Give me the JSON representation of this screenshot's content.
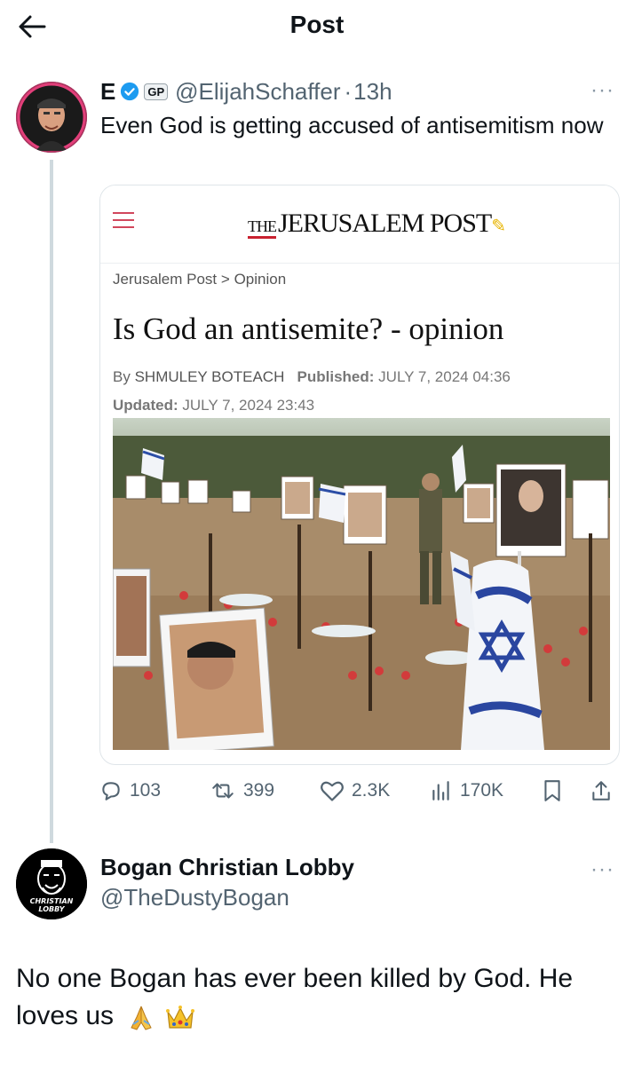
{
  "header": {
    "title": "Post",
    "back_icon": "arrow-left-icon"
  },
  "tweet1": {
    "name": "E",
    "badge": "GP",
    "handle": "@ElijahSchaffer",
    "separator": "·",
    "time": "13h",
    "text": "Even God is getting accused of antisemitism now",
    "more": "···",
    "card": {
      "masthead_the": "THE",
      "masthead": "JERUSALEM POST",
      "breadcrumb_site": "Jerusalem Post",
      "breadcrumb_sep": ">",
      "breadcrumb_section": "Opinion",
      "title": "Is God an antisemite? - opinion",
      "by_label": "By",
      "author": "SHMULEY BOTEACH",
      "published_label": "Published:",
      "published": "JULY 7, 2024 04:36",
      "updated_label": "Updated:",
      "updated": "JULY 7, 2024 23:43"
    },
    "stats": {
      "replies": "103",
      "reposts": "399",
      "likes": "2.3K",
      "views": "170K"
    }
  },
  "tweet2": {
    "name": "Bogan Christian Lobby",
    "handle": "@TheDustyBogan",
    "avatar_text": "CHRISTIAN LOBBY",
    "text": "No one Bogan has ever been killed by God. He loves us",
    "emojis": "🙏👑",
    "more": "···"
  },
  "colors": {
    "accent_blue": "#1d9bf0",
    "muted": "#536471",
    "masthead_red": "#c8202f"
  }
}
